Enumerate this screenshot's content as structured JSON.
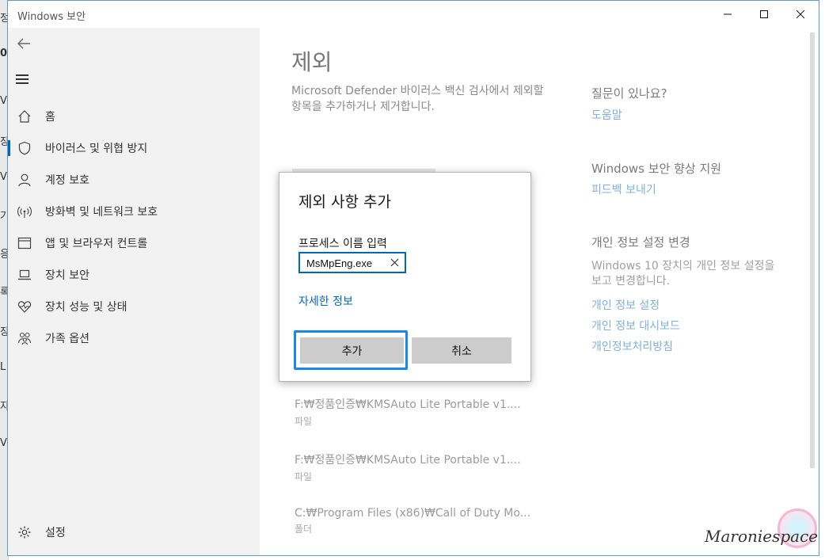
{
  "window": {
    "title": "Windows 보안",
    "controls": {
      "minimize": "minimize",
      "maximize": "maximize",
      "close": "close"
    }
  },
  "background_window": {
    "fragments": [
      "정",
      "0",
      "V",
      "장",
      "V",
      "기",
      "응",
      "록",
      "장",
      "L",
      "자",
      "V"
    ]
  },
  "sidebar": {
    "items": [
      {
        "label": "홈",
        "icon": "home-icon"
      },
      {
        "label": "바이러스 및 위협 방지",
        "icon": "shield-icon",
        "active": true
      },
      {
        "label": "계정 보호",
        "icon": "person-icon"
      },
      {
        "label": "방화벽 및 네트워크 보호",
        "icon": "wifi-icon"
      },
      {
        "label": "앱 및 브라우저 컨트롤",
        "icon": "app-browser-icon"
      },
      {
        "label": "장치 보안",
        "icon": "laptop-icon"
      },
      {
        "label": "장치 성능 및 상태",
        "icon": "heart-icon"
      },
      {
        "label": "가족 옵션",
        "icon": "family-icon"
      }
    ],
    "settings_label": "설정"
  },
  "main": {
    "title": "제외",
    "description": "Microsoft Defender 바이러스 백신 검사에서 제외할 항목을 추가하거나 제거합니다.",
    "exclusions": [
      {
        "path": "F:₩정품인증₩KMSAuto Lite Portable v1....",
        "type": "파일"
      },
      {
        "path": "F:₩정품인증₩KMSAuto Lite Portable v1....",
        "type": "파일"
      },
      {
        "path": "C:₩Program Files (x86)₩Call of Duty Mo...",
        "type": "폴더"
      }
    ]
  },
  "right_panel": {
    "question_heading": "질문이 있나요?",
    "help_link": "도움말",
    "improve_heading": "Windows 보안 향상 지원",
    "feedback_link": "피드백 보내기",
    "privacy_heading": "개인 정보 설정 변경",
    "privacy_desc": "Windows 10 장치의 개인 정보 설정을 보고 변경합니다.",
    "privacy_links": [
      "개인 정보 설정",
      "개인 정보 대시보드",
      "개인정보처리방침"
    ]
  },
  "dialog": {
    "title": "제외 사항 추가",
    "input_label": "프로세스 이름 입력",
    "input_value": "MsMpEng.exe",
    "more_info_link": "자세한 정보",
    "add_button": "추가",
    "cancel_button": "취소"
  },
  "watermark": {
    "text": "Maroniespace"
  },
  "colors": {
    "accent": "#0067c0",
    "focus_ring": "#1a86f0",
    "link_muted": "#7fb0e0"
  }
}
